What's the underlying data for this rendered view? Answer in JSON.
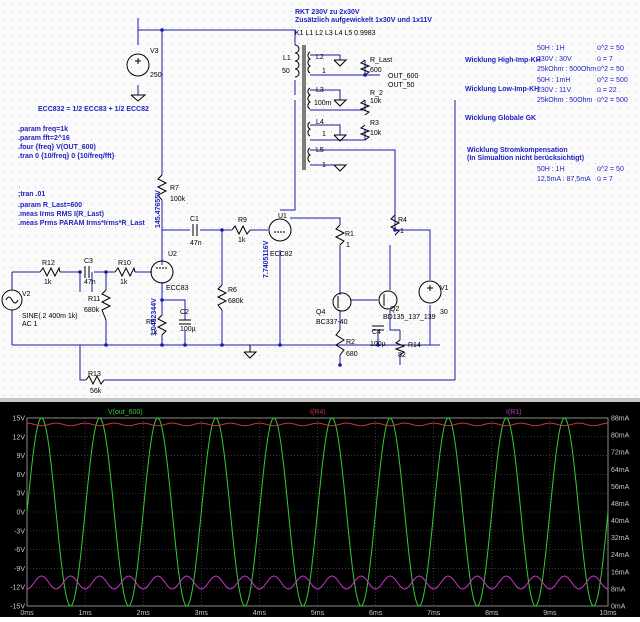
{
  "schematic": {
    "title_lines": [
      "RKT 230V zu 2x30V",
      "Zusätzlich aufgewickelt 1x30V und 1x11V"
    ],
    "coupling": "K1 L1 L2 L3 L4 L5 0.9983",
    "tube_note": "ECC832 = 1/2 ECC83 + 1/2 ECC82",
    "directives_a": [
      ".param freq=1k",
      ".param fft=2^16",
      ".four {freq} V(OUT_600)",
      ".tran 0 {10/freq} 0 {10/freq/fft}"
    ],
    "directives_b": [
      ";tran .01",
      ".param R_Last=600",
      ".meas Irms RMS I(R_Last)",
      ".meas Prms PARAM Irms*Irms*R_Last"
    ],
    "parts": {
      "V3": "V3",
      "V3_val": "250",
      "V2": "V2",
      "V2_val": "SINE(.2 400m 1k)",
      "V2_ac": "AC 1",
      "V1": "V1",
      "V1_val": "30",
      "R12": "R12",
      "R12_val": "1k",
      "C3": "C3",
      "C3_val": "47n",
      "R10": "R10",
      "R10_val": "1k",
      "R11": "R11",
      "R11_val": "680k",
      "U2": "U2",
      "U2_val": "ECC83",
      "R7": "R7",
      "R7_val": "100k",
      "C1": "C1",
      "C1_val": "47n",
      "R9": "R9",
      "R9_val": "1k",
      "R6": "R6",
      "R6_val": "680k",
      "U1": "U1",
      "U1_val": "ECC82",
      "R8": "R8",
      "R8_val": "1k",
      "C2": "C2",
      "C2_val": "100µ",
      "R13": "R13",
      "R13_val": "56k",
      "L1": "L1",
      "L1_val": "50",
      "L2": "L2",
      "L2_val": "1",
      "L3": "L3",
      "L3_val": "100m",
      "L4": "L4",
      "L4_val": "1",
      "L5": "L5",
      "L5_val": "1",
      "R_Last": "R_Last",
      "R_Last_val": "600",
      "R_2": "R_2",
      "R_2_val": "10k",
      "R3": "R3",
      "R3_val": "10k",
      "R1": "R1",
      "R1_val": "1",
      "R4": "R4",
      "R4_val": "1",
      "Q4": "Q4",
      "Q4_val": "BC337-40",
      "Q2": "Q2",
      "Q2_val": "BD135_137_139",
      "R2": "R2",
      "R2_val": "680",
      "C4": "C4",
      "C4_val": "100µ",
      "R14": "R14",
      "R14_val": "82",
      "OUT_600": "OUT_600",
      "OUT_50": "OUT_50",
      "node_v1": "145.47655V",
      "node_v2": "7.7405116V",
      "node_v3": "1.0452344V"
    },
    "right_notes": {
      "hk_title": "Wicklung High-Imp-KH",
      "hk_l1": "50H : 1H",
      "hk_r1": "ü^2 = 50",
      "hk_l2": "230V : 30V",
      "hk_r2": "ü = 7",
      "hk_l3": "25kOhm : 500Ohm",
      "hk_r3": "ü^2 = 50",
      "lk_title": "Wicklung Low-Imp-KH",
      "lk_l1": "50H : 1mH",
      "lk_r1": "ü^2 = 500",
      "lk_l2": "230V : 11V",
      "lk_r2": "ü = 22",
      "lk_l3": "25kOhm : 50Ohm",
      "lk_r3": "ü^2 = 500",
      "gk_title": "Wicklung Globale GK",
      "sk_title1": "Wicklung Stromkompensation",
      "sk_title2": "(In Simualtion nicht berücksichtigt)",
      "sk_l1": "50H : 1H",
      "sk_r1": "ü^2 = 50",
      "sk_l2": "12,5mA : 87,5mA",
      "sk_r2": "ü = 7"
    }
  },
  "chart_data": {
    "type": "line",
    "x_unit": "ms",
    "x_ticks": [
      "0ms",
      "1ms",
      "2ms",
      "3ms",
      "4ms",
      "5ms",
      "6ms",
      "7ms",
      "8ms",
      "9ms",
      "10ms"
    ],
    "xlim": [
      0,
      10
    ],
    "y_left_ticks": [
      "15V",
      "12V",
      "9V",
      "6V",
      "3V",
      "0V",
      "-3V",
      "-6V",
      "-9V",
      "-12V",
      "-15V"
    ],
    "ylim_left": [
      -15,
      15
    ],
    "y_right_ticks": [
      "88mA",
      "80mA",
      "72mA",
      "64mA",
      "56mA",
      "48mA",
      "40mA",
      "32mA",
      "24mA",
      "16mA",
      "8mA",
      "0mA"
    ],
    "ylim_right": [
      0,
      88
    ],
    "grid": true,
    "series": [
      {
        "name": "V(out_600)",
        "color": "#33cc33",
        "axis": "left",
        "offset": 0,
        "amplitude": 15,
        "freq_khz": 1,
        "phase_deg": 0
      },
      {
        "name": "I(R4)",
        "color": "#cc3344",
        "axis": "right",
        "offset": 85,
        "amplitude": 0.6,
        "freq_khz": 2,
        "phase_deg": 90
      },
      {
        "name": "I(R1)",
        "color": "#cc33cc",
        "axis": "right",
        "offset": 11,
        "amplitude": 3,
        "freq_khz": 2,
        "phase_deg": -90
      }
    ]
  }
}
